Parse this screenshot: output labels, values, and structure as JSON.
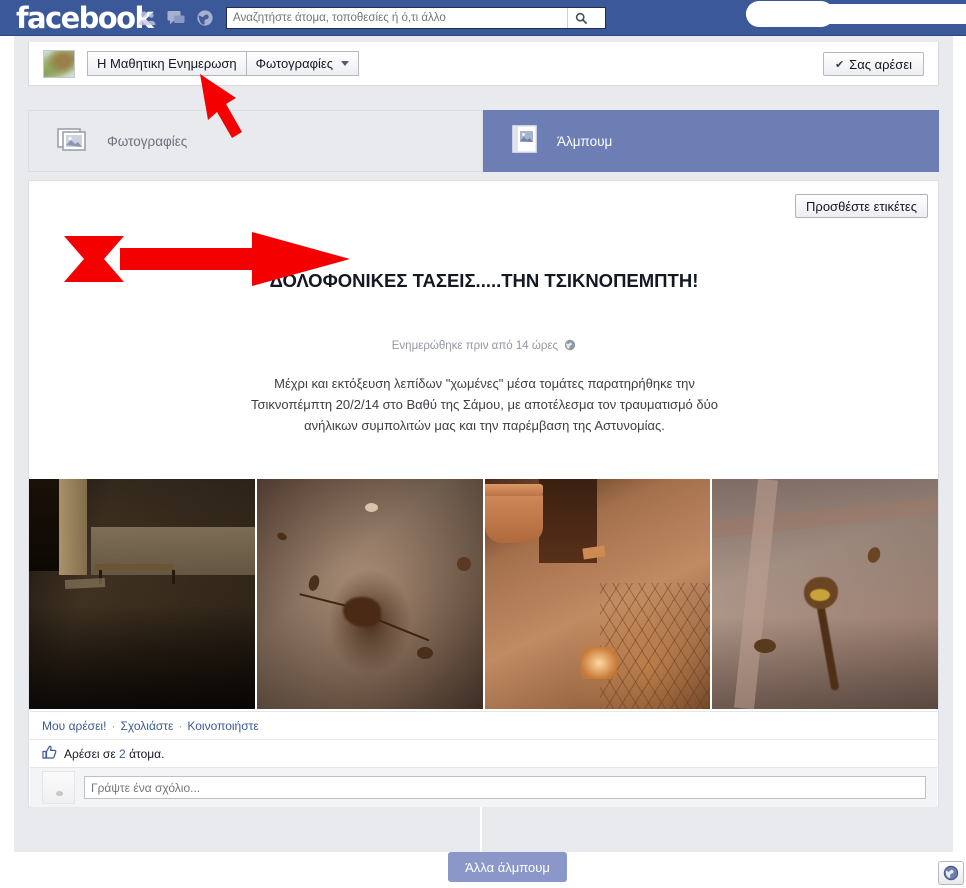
{
  "header": {
    "logo": "facebook",
    "icons": [
      "friend-requests-icon",
      "messages-icon",
      "notifications-globe-icon"
    ],
    "search": {
      "placeholder": "Αναζητήστε άτομα, τοποθεσίες ή ό,τι άλλο",
      "value": "",
      "button_icon": "search-icon"
    },
    "account_area_redacted": true,
    "brand_color": "#3b5998"
  },
  "breadcrumb": {
    "avatar_icon": "page-avatar-island-map",
    "page_name": "Η Μαθητικη Ενημερωση",
    "section": "Φωτογραφίες",
    "caret_icon": "chevron-down-icon",
    "like_button": {
      "label": "Σας αρέσει",
      "icon": "check-icon"
    }
  },
  "tabs": [
    {
      "label": "Φωτογραφίες",
      "icon": "photos-stack-icon",
      "active": false
    },
    {
      "label": "Άλμπουμ",
      "icon": "album-book-icon",
      "active": true
    }
  ],
  "album": {
    "tags_button": "Προσθέστε ετικέτες",
    "title": "ΔΟΛΟΦΟΝΙΚΕΣ ΤΑΣΕΙΣ.....ΤΗΝ ΤΣΙΚΝΟΠΕΜΠΤΗ!",
    "updated": "Ενημερώθηκε πριν από 14 ώρες",
    "privacy_icon": "globe-icon",
    "description": "Μέχρι και εκτόξευση λεπίδων \"χωμένες\" μέσα τομάτες παρατηρήθηκε την Τσικνοπέμπτη 20/2/14 στο Βαθύ της Σάμου, με αποτέλεσμα τον τραυματισμό δύο ανήλικων συμπολιτών μας και την παρέμβαση της Αστυνομίας.",
    "photos": [
      {
        "name": "photo-1",
        "alt": "Σκοτεινός δρόμος με παγκάκι τη νύχτα"
      },
      {
        "name": "photo-2",
        "alt": "Κηλίδα σε πεζοδρόμιο"
      },
      {
        "name": "photo-3",
        "alt": "Γλάστρα και πλακόστρωτο"
      },
      {
        "name": "photo-4",
        "alt": "Κηλίδα σε πλακάκια"
      }
    ]
  },
  "actions": {
    "like": "Μου αρέσει!",
    "comment": "Σχολιάστε",
    "share": "Κοινοποιήστε",
    "separator": "·"
  },
  "likes": {
    "thumb_icon": "thumbs-up-icon",
    "prefix": "Αρέσει σε",
    "count": "2",
    "suffix": "άτομα."
  },
  "comment_box": {
    "avatar_icon": "user-avatar",
    "placeholder": "Γράψτε ένα σχόλιο...",
    "value": ""
  },
  "footer": {
    "more_albums": "Άλλα άλμπουμ",
    "globe_button_icon": "globe-icon"
  },
  "annotations": {
    "color": "#f40000",
    "arrow_diagonal": "points-up-left-to-breadcrumb",
    "arrow_horizontal": "points-right-to-album-title"
  }
}
